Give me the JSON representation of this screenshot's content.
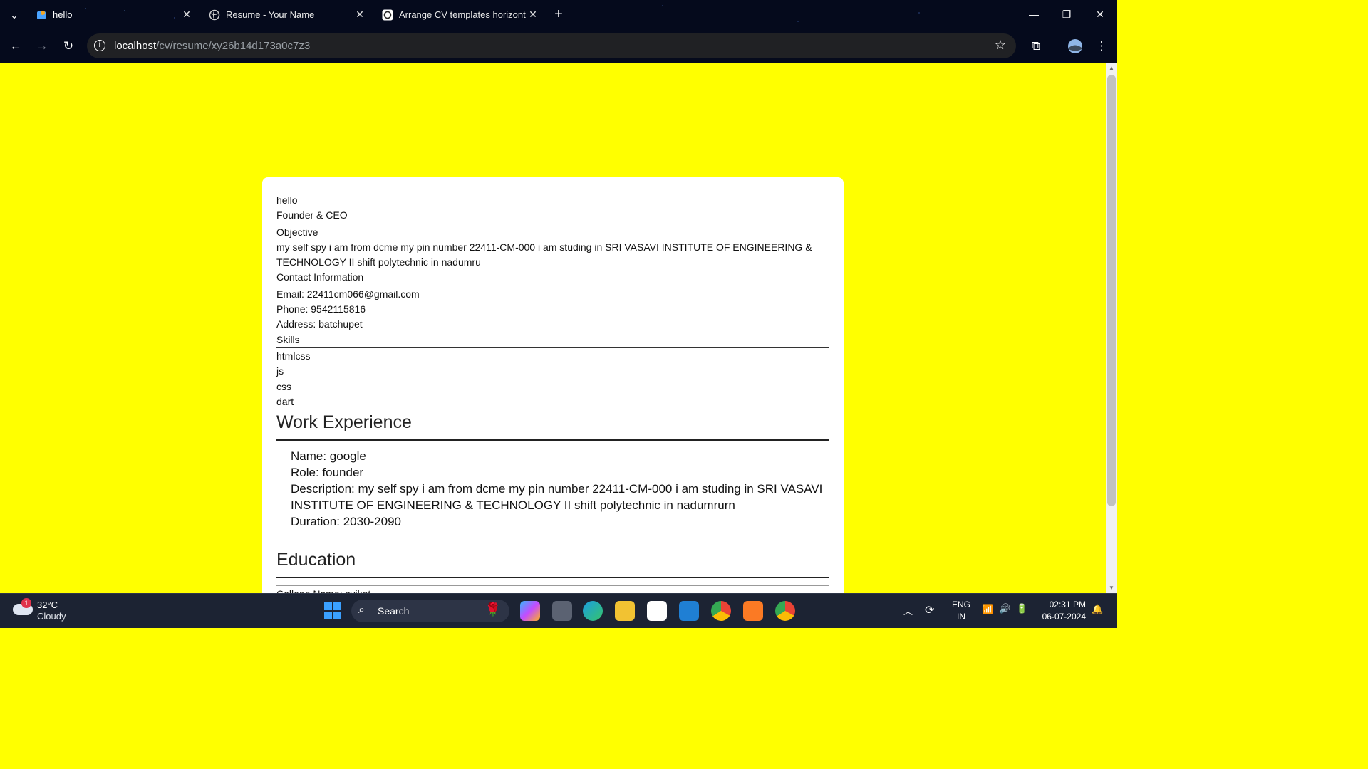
{
  "browser": {
    "tabs": [
      {
        "title": "hello",
        "active": true
      },
      {
        "title": "Resume - Your Name",
        "active": false
      },
      {
        "title": "Arrange CV templates horizonta",
        "active": false
      }
    ],
    "url_host": "localhost",
    "url_path": "/cv/resume/xy26b14d173a0c7z3"
  },
  "resume": {
    "name": "hello",
    "title": "Founder & CEO",
    "objective_heading": "Objective",
    "objective_text": "my self spy i am from dcme my pin number 22411-CM-000 i am studing in SRI VASAVI INSTITUTE OF ENGINEERING & TECHNOLOGY II shift polytechnic in nadumru",
    "contact_heading": "Contact Information",
    "email": "Email: 22411cm066@gmail.com",
    "phone": "Phone: 9542115816",
    "address": "Address: batchupet",
    "skills_heading": "Skills",
    "skills": [
      "htmlcss",
      "js",
      "css",
      "dart"
    ],
    "work_heading": "Work Experience",
    "work": {
      "name": "Name: google",
      "role": "Role: founder",
      "description": "Description: my self spy i am from dcme my pin number 22411-CM-000 i am studing in SRI VASAVI INSTITUTE OF ENGINEERING & TECHNOLOGY II shift polytechnic in nadumrurn",
      "duration": "Duration: 2030-2090"
    },
    "education_heading": "Education",
    "college": "College Name: svikot"
  },
  "taskbar": {
    "temperature": "32°C",
    "condition": "Cloudy",
    "weather_badge": "1",
    "search_label": "Search",
    "lang_line1": "ENG",
    "lang_line2": "IN",
    "time": "02:31 PM",
    "date": "06-07-2024"
  },
  "colors": {
    "page_background": "#ffff00",
    "card_background": "#ffffff",
    "browser_chrome": "#050a1c"
  }
}
